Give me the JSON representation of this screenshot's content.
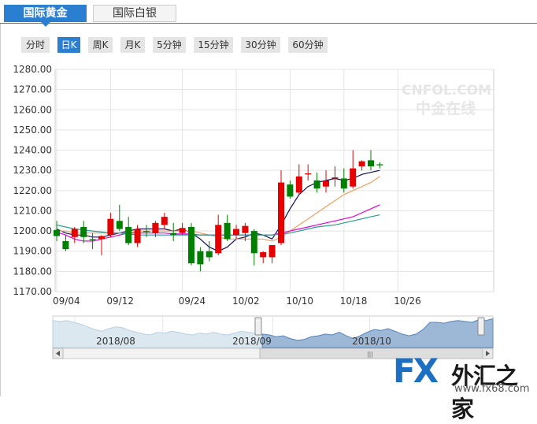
{
  "tabs": [
    {
      "label": "国际黄金",
      "active": true
    },
    {
      "label": "国际白银",
      "active": false
    }
  ],
  "periods": [
    {
      "label": "分时",
      "active": false
    },
    {
      "label": "日K",
      "active": true
    },
    {
      "label": "周K",
      "active": false
    },
    {
      "label": "月K",
      "active": false
    },
    {
      "label": "5分钟",
      "active": false
    },
    {
      "label": "15分钟",
      "active": false
    },
    {
      "label": "30分钟",
      "active": false
    },
    {
      "label": "60分钟",
      "active": false
    }
  ],
  "watermark": {
    "top": "CNFOL.COM",
    "bottom": "中金在线"
  },
  "brand": {
    "fx": "FX",
    "name": "外汇之家",
    "url": "www.fx68.com"
  },
  "colors": {
    "up": "#e60000",
    "down": "#008000",
    "accent": "#2b7fd0",
    "ma5": "#10105a",
    "ma10": "#f0a060",
    "ma20": "#e000e0",
    "ma30": "#2a9d8f"
  },
  "chart_data": {
    "type": "candlestick",
    "ylim": [
      1170,
      1280
    ],
    "y_ticks": [
      "1280.00",
      "1270.00",
      "1260.00",
      "1250.00",
      "1240.00",
      "1230.00",
      "1220.00",
      "1210.00",
      "1200.00",
      "1190.00",
      "1180.00",
      "1170.00"
    ],
    "x_tick_labels": [
      {
        "label": "09/04",
        "index": 0
      },
      {
        "label": "09/12",
        "index": 6
      },
      {
        "label": "09/24",
        "index": 14
      },
      {
        "label": "10/02",
        "index": 20
      },
      {
        "label": "10/10",
        "index": 26
      },
      {
        "label": "10/18",
        "index": 32
      },
      {
        "label": "10/26",
        "index": 38
      }
    ],
    "candles": [
      {
        "o": 1200.5,
        "h": 1205,
        "c": 1197.5,
        "l": 1195
      },
      {
        "o": 1195,
        "h": 1198,
        "c": 1191,
        "l": 1190
      },
      {
        "o": 1197,
        "h": 1202,
        "c": 1201,
        "l": 1194
      },
      {
        "o": 1202,
        "h": 1205,
        "c": 1197,
        "l": 1194
      },
      {
        "o": 1196,
        "h": 1199,
        "c": 1195.5,
        "l": 1191
      },
      {
        "o": 1196,
        "h": 1198,
        "c": 1197.5,
        "l": 1188
      },
      {
        "o": 1198,
        "h": 1209,
        "c": 1206,
        "l": 1197
      },
      {
        "o": 1205,
        "h": 1213,
        "c": 1201,
        "l": 1200
      },
      {
        "o": 1202,
        "h": 1207,
        "c": 1194,
        "l": 1193
      },
      {
        "o": 1194,
        "h": 1203,
        "c": 1201,
        "l": 1192
      },
      {
        "o": 1200,
        "h": 1203,
        "c": 1199.5,
        "l": 1197
      },
      {
        "o": 1199,
        "h": 1205,
        "c": 1204,
        "l": 1197
      },
      {
        "o": 1203,
        "h": 1209,
        "c": 1207,
        "l": 1201
      },
      {
        "o": 1199,
        "h": 1204,
        "c": 1198,
        "l": 1195
      },
      {
        "o": 1199,
        "h": 1204,
        "c": 1201.5,
        "l": 1198
      },
      {
        "o": 1202,
        "h": 1204,
        "c": 1184,
        "l": 1183
      },
      {
        "o": 1190,
        "h": 1192,
        "c": 1183.5,
        "l": 1180
      },
      {
        "o": 1190,
        "h": 1195,
        "c": 1187,
        "l": 1185
      },
      {
        "o": 1189,
        "h": 1208,
        "c": 1203,
        "l": 1188
      },
      {
        "o": 1204,
        "h": 1208,
        "c": 1196,
        "l": 1195
      },
      {
        "o": 1198,
        "h": 1203,
        "c": 1201,
        "l": 1196
      },
      {
        "o": 1199,
        "h": 1204,
        "c": 1202.5,
        "l": 1195
      },
      {
        "o": 1200,
        "h": 1201,
        "c": 1189,
        "l": 1183
      },
      {
        "o": 1187,
        "h": 1190,
        "c": 1189.5,
        "l": 1184
      },
      {
        "o": 1187,
        "h": 1193,
        "c": 1193,
        "l": 1184
      },
      {
        "o": 1194,
        "h": 1230,
        "c": 1224,
        "l": 1193
      },
      {
        "o": 1223,
        "h": 1225,
        "c": 1217,
        "l": 1216
      },
      {
        "o": 1219,
        "h": 1233,
        "c": 1227,
        "l": 1218
      },
      {
        "o": 1228,
        "h": 1233,
        "c": 1228.5,
        "l": 1225
      },
      {
        "o": 1225,
        "h": 1229,
        "c": 1221,
        "l": 1219
      },
      {
        "o": 1222,
        "h": 1230,
        "c": 1225,
        "l": 1219
      },
      {
        "o": 1226,
        "h": 1232,
        "c": 1226.5,
        "l": 1222
      },
      {
        "o": 1226,
        "h": 1231,
        "c": 1221,
        "l": 1219
      },
      {
        "o": 1222,
        "h": 1240,
        "c": 1231,
        "l": 1221
      },
      {
        "o": 1232,
        "h": 1235,
        "c": 1234.5,
        "l": 1230
      },
      {
        "o": 1235,
        "h": 1240,
        "c": 1232,
        "l": 1230
      },
      {
        "o": 1233,
        "h": 1234,
        "c": 1232.5,
        "l": 1231
      }
    ],
    "series": [
      {
        "key": "ma5",
        "values": [
          1201,
          1199,
          1198,
          1198,
          1197,
          1197,
          1198,
          1199,
          1200,
          1201,
          1201,
          1201,
          1201,
          1200,
          1201,
          1199,
          1196,
          1192,
          1190,
          1192,
          1196,
          1197,
          1199,
          1198,
          1196,
          1203,
          1211,
          1218,
          1222,
          1224,
          1225,
          1226,
          1225,
          1226,
          1228,
          1229,
          1230
        ]
      },
      {
        "key": "ma10",
        "values": [
          1200,
          1200,
          1199,
          1199,
          1199,
          1199,
          1199,
          1199,
          1199,
          1200,
          1200,
          1200,
          1200,
          1200,
          1200,
          1200,
          1199,
          1198,
          1197,
          1196,
          1196,
          1196,
          1196,
          1196,
          1195,
          1197,
          1200,
          1203,
          1206,
          1209,
          1212,
          1215,
          1218,
          1220,
          1222,
          1224,
          1227
        ]
      },
      {
        "key": "ma20",
        "values": [
          1199.5,
          1198,
          1196,
          1195,
          1195,
          1196,
          1197,
          1198,
          1199,
          1199,
          1199,
          1199,
          1199,
          1198.5,
          1198.5,
          1198.5,
          1198,
          1198,
          1198,
          1198,
          1198,
          1198,
          1198,
          1198,
          1198,
          1199,
          1200,
          1201,
          1202,
          1203,
          1204,
          1205,
          1206,
          1207,
          1209,
          1211,
          1213
        ]
      },
      {
        "key": "ma30",
        "values": [
          1203,
          1202,
          1201,
          1200.5,
          1200,
          1199.5,
          1199,
          1199,
          1198.5,
          1198,
          1198,
          1198,
          1198,
          1198,
          1198,
          1198,
          1198,
          1198,
          1198,
          1198,
          1198,
          1198,
          1198,
          1198,
          1198,
          1198.5,
          1199,
          1200,
          1201,
          1202,
          1202.5,
          1203,
          1204,
          1205,
          1206,
          1207,
          1208
        ]
      }
    ],
    "navigator": {
      "labels": [
        "2018/08",
        "2018/09",
        "2018/10"
      ],
      "values": [
        1230,
        1228,
        1230,
        1226,
        1222,
        1216,
        1210,
        1206,
        1212,
        1216,
        1214,
        1208,
        1204,
        1200,
        1198,
        1204,
        1202,
        1206,
        1204,
        1200,
        1198,
        1202,
        1200,
        1204,
        1200,
        1198,
        1202,
        1206,
        1204,
        1202,
        1200,
        1198,
        1194,
        1196,
        1190,
        1186,
        1188,
        1194,
        1196,
        1200,
        1198,
        1204,
        1196,
        1190,
        1196,
        1204,
        1210,
        1208,
        1212,
        1206,
        1200,
        1196,
        1200,
        1210,
        1226,
        1226,
        1224,
        1228,
        1230,
        1228,
        1226,
        1232,
        1230,
        1234
      ],
      "selection": [
        0.48,
        1.0
      ]
    }
  }
}
